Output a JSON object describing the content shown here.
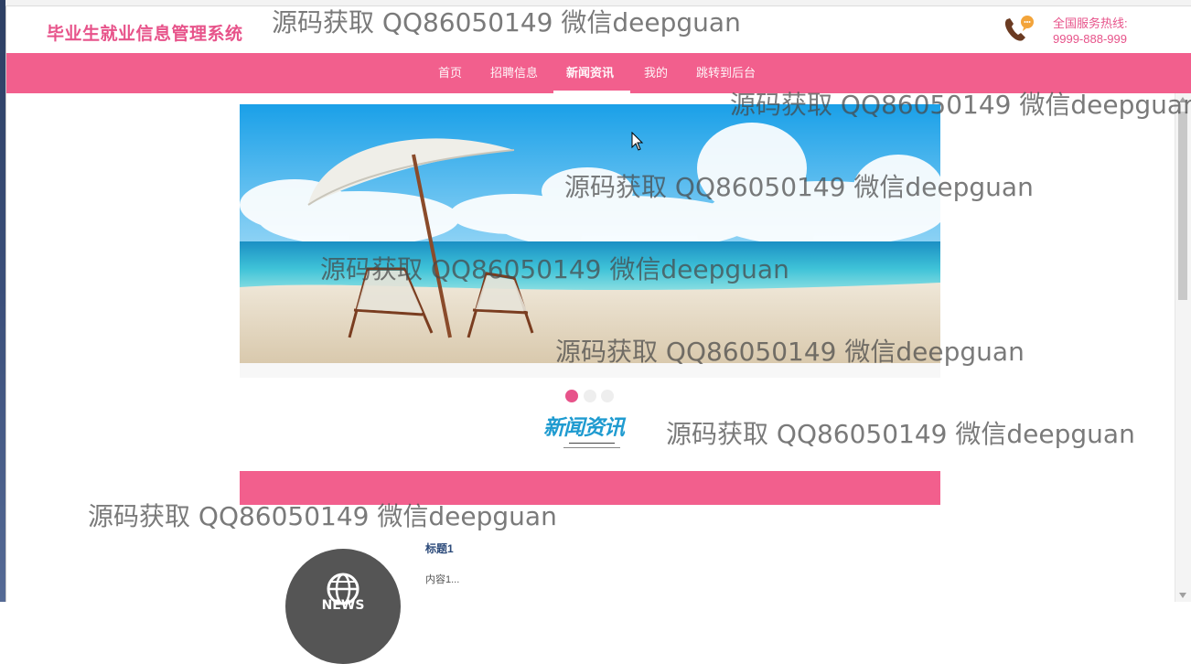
{
  "header": {
    "logo": "毕业生就业信息管理系统",
    "hotline_label": "全国服务热线:",
    "hotline_number": "9999-888-999",
    "phone_icon": "phone-chat-icon"
  },
  "nav": {
    "items": [
      {
        "label": "首页"
      },
      {
        "label": "招聘信息"
      },
      {
        "label": "新闻资讯"
      },
      {
        "label": "我的"
      },
      {
        "label": "跳转到后台"
      }
    ],
    "active": "新闻资讯"
  },
  "carousel": {
    "dots": 3,
    "active_index": 0
  },
  "section": {
    "title": "新闻资讯"
  },
  "news": [
    {
      "title": "标题1",
      "content": "内容1...",
      "thumb_text": "NEWS"
    }
  ],
  "watermark": "源码获取 QQ86050149 微信deepguan",
  "colors": {
    "accent": "#f25f8d",
    "logo": "#e7538a",
    "section_title": "#1f9bd0"
  }
}
